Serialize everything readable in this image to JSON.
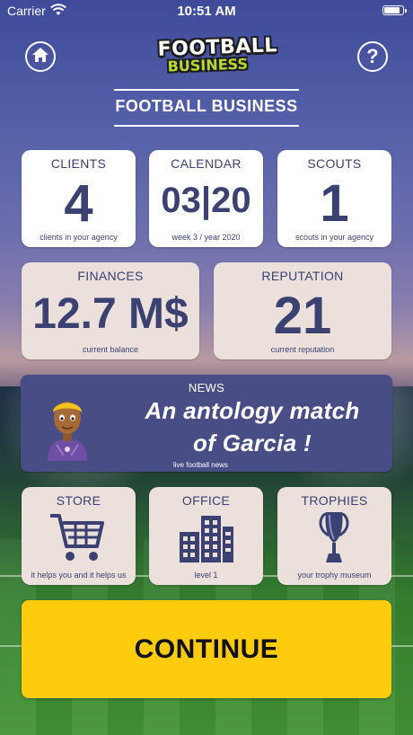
{
  "status_bar": {
    "carrier": "Carrier",
    "time": "10:51 AM",
    "battery_level": 0.9
  },
  "header": {
    "logo_line1": "FOOTBALL",
    "logo_line2": "BUSINESS",
    "title": "FOOTBALL BUSINESS",
    "home_icon": "home-icon",
    "help_icon": "help-icon",
    "help_glyph": "?"
  },
  "stats": {
    "clients": {
      "label": "CLIENTS",
      "value": "4",
      "caption": "clients in your agency"
    },
    "calendar": {
      "label": "CALENDAR",
      "value": "03|20",
      "caption": "week 3 / year 2020"
    },
    "scouts": {
      "label": "SCOUTS",
      "value": "1",
      "caption": "scouts in your agency"
    },
    "finances": {
      "label": "FINANCES",
      "value": "12.7 M$",
      "caption": "current balance"
    },
    "reputation": {
      "label": "REPUTATION",
      "value": "21",
      "caption": "current reputation"
    }
  },
  "news": {
    "label": "NEWS",
    "headline_line1": "An antology match",
    "headline_line2": "of Garcia !",
    "caption": "live football news"
  },
  "menu": {
    "store": {
      "label": "STORE",
      "caption": "it helps you and it helps us",
      "icon": "shopping-cart-icon"
    },
    "office": {
      "label": "OFFICE",
      "caption": "level 1",
      "icon": "office-building-icon"
    },
    "trophies": {
      "label": "TROPHIES",
      "caption": "your trophy museum",
      "icon": "trophy-icon"
    }
  },
  "continue_label": "CONTINUE",
  "colors": {
    "card_text": "#3b4170",
    "news_bg": "#484e85",
    "beige_card": "#ebe0dc",
    "continue_bg": "#fecc0c"
  }
}
